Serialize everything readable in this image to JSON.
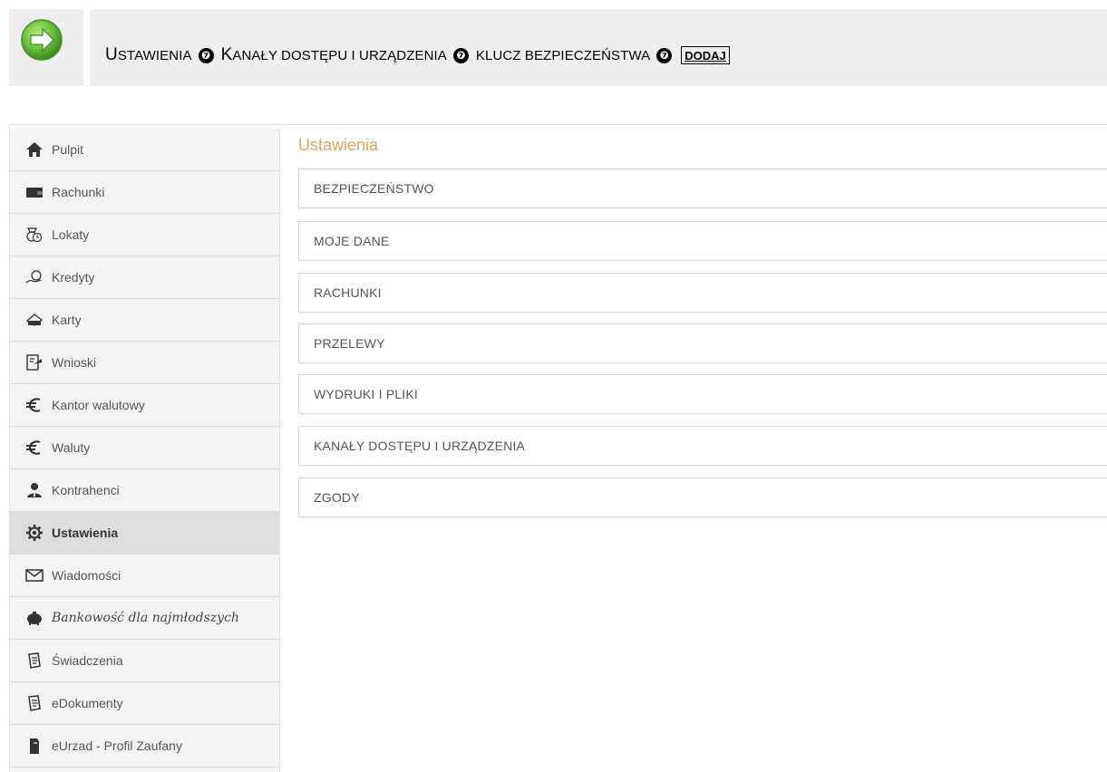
{
  "instruction": {
    "crumbs": [
      {
        "first": "U",
        "rest": "stawienia"
      },
      {
        "first": "K",
        "rest": "anały dostępu i urządzenia"
      },
      {
        "first": "",
        "rest": "klucz bezpieczeństwa"
      }
    ],
    "separator_glyph": "❼",
    "final": "dodaj"
  },
  "sidebar": {
    "items": [
      {
        "label": "Pulpit",
        "icon": "home-icon"
      },
      {
        "label": "Rachunki",
        "icon": "wallet-icon"
      },
      {
        "label": "Lokaty",
        "icon": "deposit-clock-icon"
      },
      {
        "label": "Kredyty",
        "icon": "credit-hand-icon"
      },
      {
        "label": "Karty",
        "icon": "card-icon"
      },
      {
        "label": "Wnioski",
        "icon": "application-form-icon"
      },
      {
        "label": "Kantor walutowy",
        "icon": "euro-icon"
      },
      {
        "label": "Waluty",
        "icon": "euro-icon"
      },
      {
        "label": "Kontrahenci",
        "icon": "contact-person-icon"
      },
      {
        "label": "Ustawienia",
        "icon": "gear-icon",
        "active": true
      },
      {
        "label": "Wiadomości",
        "icon": "envelope-icon"
      },
      {
        "label": "Bankowość dla najmłodszych",
        "icon": "piggy-bank-icon"
      },
      {
        "label": "Świadczenia",
        "icon": "document-icon"
      },
      {
        "label": "eDokumenty",
        "icon": "document-icon"
      },
      {
        "label": "eUrzad - Profil Zaufany",
        "icon": "profile-document-icon"
      }
    ]
  },
  "main": {
    "title": "Ustawienia",
    "sections": [
      "BEZPIECZEŃSTWO",
      "MOJE DANE",
      "RACHUNKI",
      "PRZELEWY",
      "WYDRUKI I PLIKI",
      "KANAŁY DOSTĘPU I URZĄDZENIA",
      "ZGODY"
    ]
  },
  "colors": {
    "title_accent": "#e8a15b",
    "arrow_green": "#6cc33c",
    "active_item_bg": "#dddddd"
  }
}
